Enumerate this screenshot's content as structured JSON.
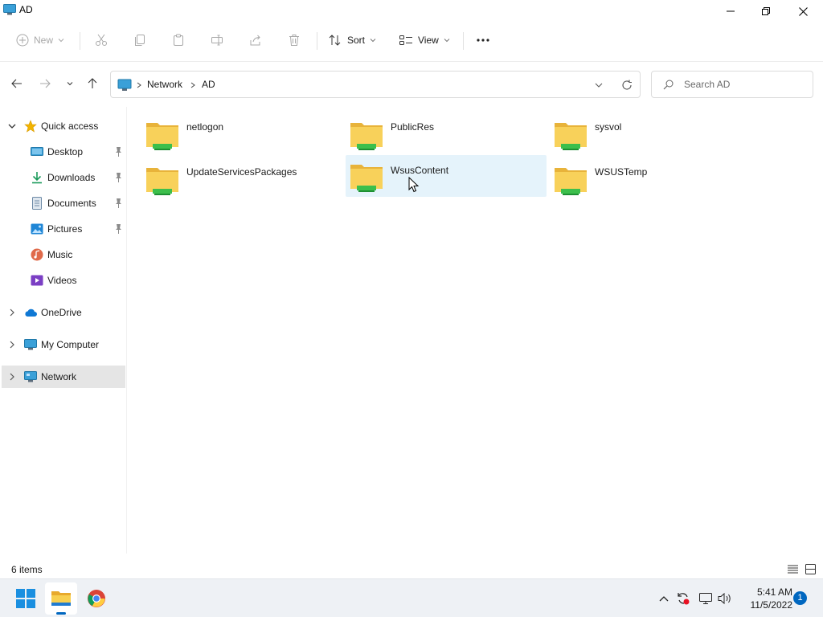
{
  "window": {
    "title": "AD",
    "icon": "monitor-icon"
  },
  "window_controls": {
    "minimize": "minimize-icon",
    "maximize": "restore-icon",
    "close": "close-icon"
  },
  "toolbar": {
    "new_label": "New",
    "sort_label": "Sort",
    "view_label": "View",
    "icons": [
      "plus-icon",
      "cut-icon",
      "copy-icon",
      "paste-icon",
      "rename-icon",
      "share-icon",
      "delete-icon",
      "sort-icon",
      "view-icon",
      "more-icon"
    ]
  },
  "address": {
    "segments": [
      "Network",
      "AD"
    ],
    "search_placeholder": "Search AD"
  },
  "nav_pane": {
    "quick_access": {
      "label": "Quick access"
    },
    "pinned": [
      {
        "label": "Desktop",
        "icon": "desktop-folder-icon"
      },
      {
        "label": "Downloads",
        "icon": "downloads-folder-icon"
      },
      {
        "label": "Documents",
        "icon": "documents-folder-icon"
      },
      {
        "label": "Pictures",
        "icon": "pictures-folder-icon"
      },
      {
        "label": "Music",
        "icon": "music-folder-icon"
      },
      {
        "label": "Videos",
        "icon": "videos-folder-icon"
      }
    ],
    "onedrive": {
      "label": "OneDrive"
    },
    "my_computer": {
      "label": "My Computer"
    },
    "network": {
      "label": "Network",
      "selected": true
    }
  },
  "content": {
    "folders": [
      {
        "name": "netlogon"
      },
      {
        "name": "PublicRes"
      },
      {
        "name": "sysvol"
      },
      {
        "name": "UpdateServicesPackages"
      },
      {
        "name": "WsusContent",
        "hovered": true
      },
      {
        "name": "WSUSTemp"
      }
    ]
  },
  "status": {
    "item_count": "6 items"
  },
  "taskbar": {
    "apps": [
      "start-icon",
      "file-explorer-icon",
      "chrome-icon"
    ],
    "tray_icons": [
      "chevron-up-icon",
      "sync-icon",
      "network-icon",
      "volume-icon"
    ],
    "time": "5:41 AM",
    "date": "11/5/2022",
    "notification_count": "1"
  },
  "colors": {
    "accent": "#0067c0",
    "folder": "#f6c94c",
    "hover": "#e5f3fb",
    "selected": "#e5e5e5"
  }
}
